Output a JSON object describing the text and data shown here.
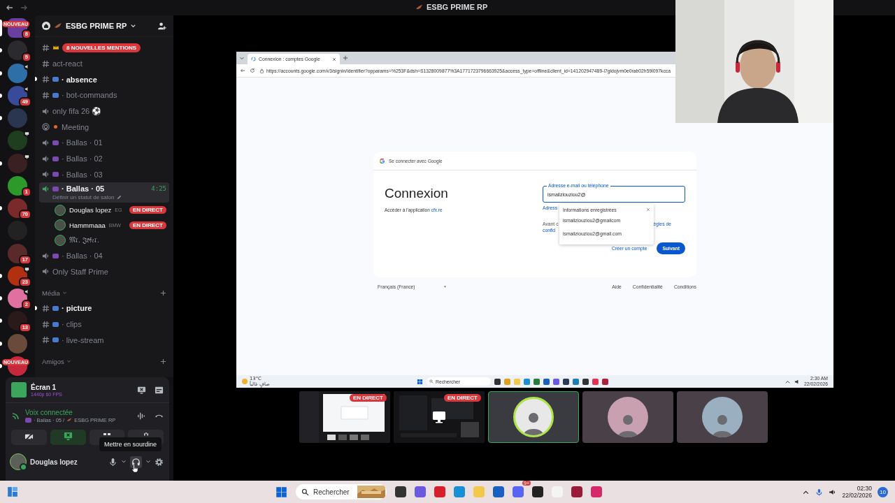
{
  "window": {
    "title": "ESBG PRIME RP"
  },
  "server_rail": [
    {
      "kind": "plain",
      "selected": true,
      "label": "NOUVEAU",
      "badge": "8"
    },
    {
      "kind": "plain",
      "selected": false,
      "unread": true,
      "badge": "5"
    },
    {
      "kind": "voice",
      "selected": false,
      "unread": true
    },
    {
      "kind": "voice",
      "selected": false,
      "unread": true,
      "badge": "49"
    },
    {
      "kind": "plain",
      "selected": false,
      "unread": true
    },
    {
      "kind": "screen",
      "selected": false,
      "unread": false
    },
    {
      "kind": "screen",
      "selected": false,
      "unread": true
    },
    {
      "kind": "plain",
      "selected": false,
      "unread": false,
      "badge": "1"
    },
    {
      "kind": "plain",
      "selected": false,
      "unread": true,
      "badge": "70"
    },
    {
      "kind": "plain",
      "selected": false,
      "unread": false
    },
    {
      "kind": "plain",
      "selected": false,
      "unread": false,
      "badge": "17"
    },
    {
      "kind": "screen",
      "selected": false,
      "unread": true,
      "badge": "23"
    },
    {
      "kind": "voice",
      "selected": false,
      "unread": true,
      "badge": "2"
    },
    {
      "kind": "plain",
      "selected": false,
      "unread": true,
      "badge": "13"
    },
    {
      "kind": "plain",
      "selected": false,
      "unread": true
    },
    {
      "kind": "plain",
      "selected": false,
      "unread": true,
      "label": "NOUVEAU"
    }
  ],
  "sidebar": {
    "server_name": "ESBG PRIME RP",
    "mentions_banner": "8 NOUVELLES MENTIONS",
    "sections": [
      {
        "channels": [
          {
            "kind": "text",
            "name": "act-react",
            "unread": false,
            "selected": false,
            "icon": false
          },
          {
            "kind": "text",
            "name": "· absence",
            "unread": true,
            "selected": false,
            "icon": true
          },
          {
            "kind": "text",
            "name": "· bot-commands",
            "unread": false,
            "selected": false,
            "icon": true
          },
          {
            "kind": "voice",
            "name": "only fifa 26 ⚽",
            "unread": false,
            "selected": false,
            "icon": false
          },
          {
            "kind": "stage",
            "name": "Meeting",
            "unread": false,
            "selected": false,
            "icon": true
          },
          {
            "kind": "voice",
            "name": "· Ballas · 01",
            "unread": false,
            "selected": false,
            "icon": true
          },
          {
            "kind": "voice",
            "name": "· Ballas · 02",
            "unread": false,
            "selected": false,
            "icon": true
          },
          {
            "kind": "voice",
            "name": "· Ballas · 03",
            "unread": false,
            "selected": false,
            "icon": true
          },
          {
            "kind": "voice",
            "name": "· Ballas · 05",
            "unread": true,
            "selected": true,
            "icon": true,
            "time": "4:25",
            "status": "Définir un statut de salon",
            "members": [
              {
                "name": "Douglas lopez",
                "tag": "EG",
                "live": "EN DIRECT"
              },
              {
                "name": "Hammmaaa",
                "tag": "BMW",
                "live": "EN DIRECT"
              },
              {
                "name": "𝔐𝔯. 𝔍𝔬𝔣𝔢𝔯."
              }
            ]
          },
          {
            "kind": "voice",
            "name": "· Ballas · 04",
            "unread": false,
            "selected": false,
            "icon": true
          },
          {
            "kind": "voice",
            "name": "Only Staff Prime",
            "unread": false,
            "selected": false,
            "icon": false
          }
        ]
      },
      {
        "category": "Média",
        "channels": [
          {
            "kind": "text",
            "name": "· picture",
            "unread": true,
            "selected": false,
            "icon": true
          },
          {
            "kind": "text",
            "name": "· clips",
            "unread": false,
            "selected": false,
            "icon": true
          },
          {
            "kind": "text",
            "name": "· live-stream",
            "unread": false,
            "selected": false,
            "icon": true
          }
        ]
      },
      {
        "category": "Amigos"
      }
    ]
  },
  "panel": {
    "stream": {
      "title": "Écran 1",
      "quality": "1440p 60 FPS"
    },
    "voice": {
      "status": "Voix connectée",
      "channel": "· Ballas · 05 /",
      "server": "ESBG PRIME RP"
    },
    "actions": [
      {
        "kind": "camera",
        "active": false
      },
      {
        "kind": "screen",
        "active": true
      },
      {
        "kind": "activity",
        "active": false
      },
      {
        "kind": "soundboard",
        "active": false
      }
    ],
    "tooltip": "Mettre en sourdine",
    "user": {
      "name": "Douglas lopez"
    }
  },
  "shared_screen": {
    "tab": "Connexion : comptes Google",
    "url": "https://accounts.google.com/v3/signin/identifier?opparams=%253F&dsh=S1328009877%3A1771723796663925&access_type=offline&client_id=141202947489-i7gldojvm0e0rab02h59l097kcca",
    "card": {
      "header": "Se connecter avec Google",
      "title": "Connexion",
      "subtitle": "Accéder à l'application",
      "app_link": "cfx.re",
      "field": {
        "label": "Adresse e-mail ou téléphone",
        "value": "ismailziouziou2@"
      },
      "fragments": {
        "link": "Adress",
        "notice": "Avant c",
        "notice_link": "confid",
        "notice_end": "ègles de"
      },
      "suggestions": {
        "title": "Informations enregistrées",
        "items": [
          "ismailziouziou2@gmailcom",
          "ismailziouziou2@gmail.com"
        ]
      },
      "buttons": {
        "secondary": "Créer un compte",
        "primary": "Suivant"
      }
    },
    "footer": {
      "language": "Français (France)",
      "links": [
        "Aide",
        "Confidentialité",
        "Conditions"
      ]
    },
    "taskbar": {
      "temperature": "13°C",
      "weather": "صافٍ غالباً",
      "search": "Rechercher",
      "time": "2:30 AM",
      "date": "22/02/2026"
    }
  },
  "tiles": [
    {
      "kind": "screen",
      "live": "EN DIRECT",
      "selected": false
    },
    {
      "kind": "screen_hidden",
      "live": "EN DIRECT",
      "selected": false
    },
    {
      "kind": "avatar",
      "selected": true
    },
    {
      "kind": "avatar",
      "selected": false
    },
    {
      "kind": "avatar",
      "selected": false
    }
  ],
  "taskbar": {
    "search": "Rechercher",
    "app_badge": "9+",
    "time": "02:30",
    "date": "22/02/2026",
    "notifications": "10"
  }
}
